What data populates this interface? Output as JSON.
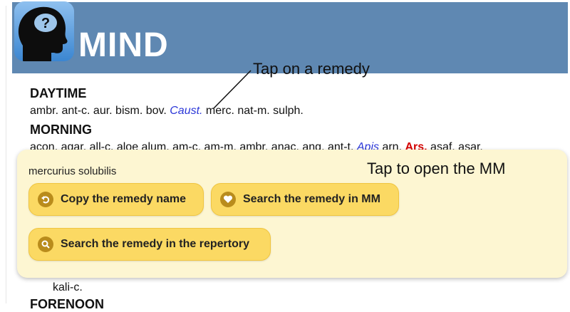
{
  "header": {
    "title": "MIND",
    "logo_icon": "head-question-icon"
  },
  "sections": [
    {
      "heading": "DAYTIME",
      "pre": "ambr. ant-c. aur. bism. bov. ",
      "link": "Caust.",
      "post": " merc. nat-m. sulph."
    },
    {
      "heading": "MORNING",
      "pre": "acon. agar. all-c. aloe alum. am-c. am-m. ambr. anac. ang. ant-t. ",
      "link": "Apis",
      "mid": " arn. ",
      "bold": "Ars.",
      "post": " asaf. asar."
    }
  ],
  "annotations": {
    "tap_remedy": "Tap on a remedy",
    "tap_mm": "Tap to open the MM"
  },
  "popup": {
    "remedy_name": "mercurius solubilis",
    "copy_label": "Copy the remedy name",
    "search_mm_label": "Search the remedy in MM",
    "search_repertory_label": "Search the remedy in the repertory"
  },
  "below": {
    "line": "kali-c.",
    "next_heading": "FORENOON"
  },
  "colors": {
    "header": "#5f88b2",
    "link": "#2a36d8",
    "bold": "#d40000",
    "popup_bg": "#fdf6d2",
    "button": "#fbd963"
  }
}
